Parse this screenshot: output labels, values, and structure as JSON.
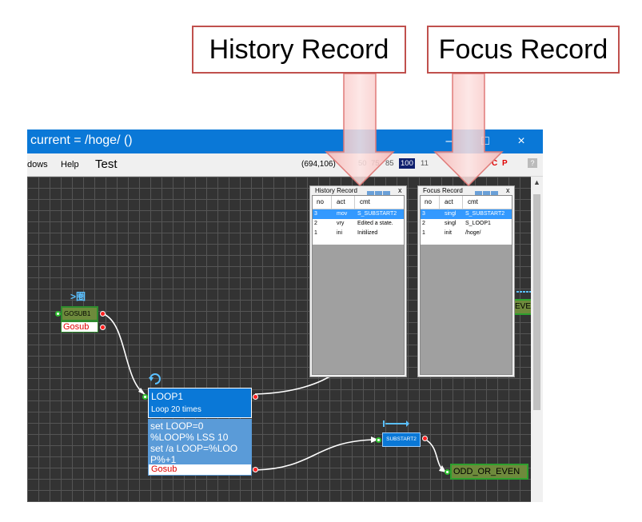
{
  "callouts": {
    "history": "History Record",
    "focus": "Focus Record"
  },
  "window": {
    "title": "current = /hoge/ ()",
    "controls": {
      "minimize": "–",
      "maximize": "□",
      "close": "×"
    }
  },
  "menubar": {
    "items": [
      "dows",
      "Help",
      "Test"
    ],
    "coords": "(694,106)",
    "zoom_levels": [
      "50",
      "75",
      "85",
      "100",
      "11"
    ],
    "zoom_selected": "100",
    "right_labels": [
      "C",
      "P",
      "?"
    ]
  },
  "history_panel": {
    "title": "History Record",
    "close": "x",
    "columns": [
      "no",
      "act",
      "cmt"
    ],
    "rows": [
      {
        "no": "3",
        "act": "mov",
        "cmt": "S_SUBSTART2",
        "selected": true
      },
      {
        "no": "2",
        "act": "vry",
        "cmt": "Edited a state.",
        "selected": false
      },
      {
        "no": "1",
        "act": "ini",
        "cmt": "Initilized",
        "selected": false
      }
    ]
  },
  "focus_panel": {
    "title": "Focus Record",
    "close": "x",
    "columns": [
      "no",
      "act",
      "cmt"
    ],
    "rows": [
      {
        "no": "3",
        "act": "singl",
        "cmt": "S_SUBSTART2",
        "selected": true
      },
      {
        "no": "2",
        "act": "singl",
        "cmt": "S_LOOP1",
        "selected": false
      },
      {
        "no": "1",
        "act": "init",
        "cmt": "/hoge/",
        "selected": false
      }
    ]
  },
  "nodes": {
    "gosub1": {
      "icon_label": ">圏",
      "name": "GOSUB1",
      "sub": "Gosub"
    },
    "loop1": {
      "name": "LOOP1",
      "desc": "Loop 20 times",
      "code": [
        "set LOOP=0",
        "%LOOP% LSS 10",
        "set /a LOOP=%LOO",
        "P%+1"
      ],
      "sub": "Gosub"
    },
    "substart2": {
      "name": "SUBSTART2"
    },
    "odd_or_even": {
      "name": "ODD_OR_EVEN",
      "partial": "EVEN"
    }
  },
  "colors": {
    "callout_border": "#c0504d",
    "title_bar": "#0a78d7",
    "selection": "#3399ff",
    "node_green": "#6e8a3c",
    "node_blue": "#0a78d7",
    "wire": "#ffffff",
    "pin_red": "#ff2020",
    "pin_green": "#2fbf2f"
  }
}
